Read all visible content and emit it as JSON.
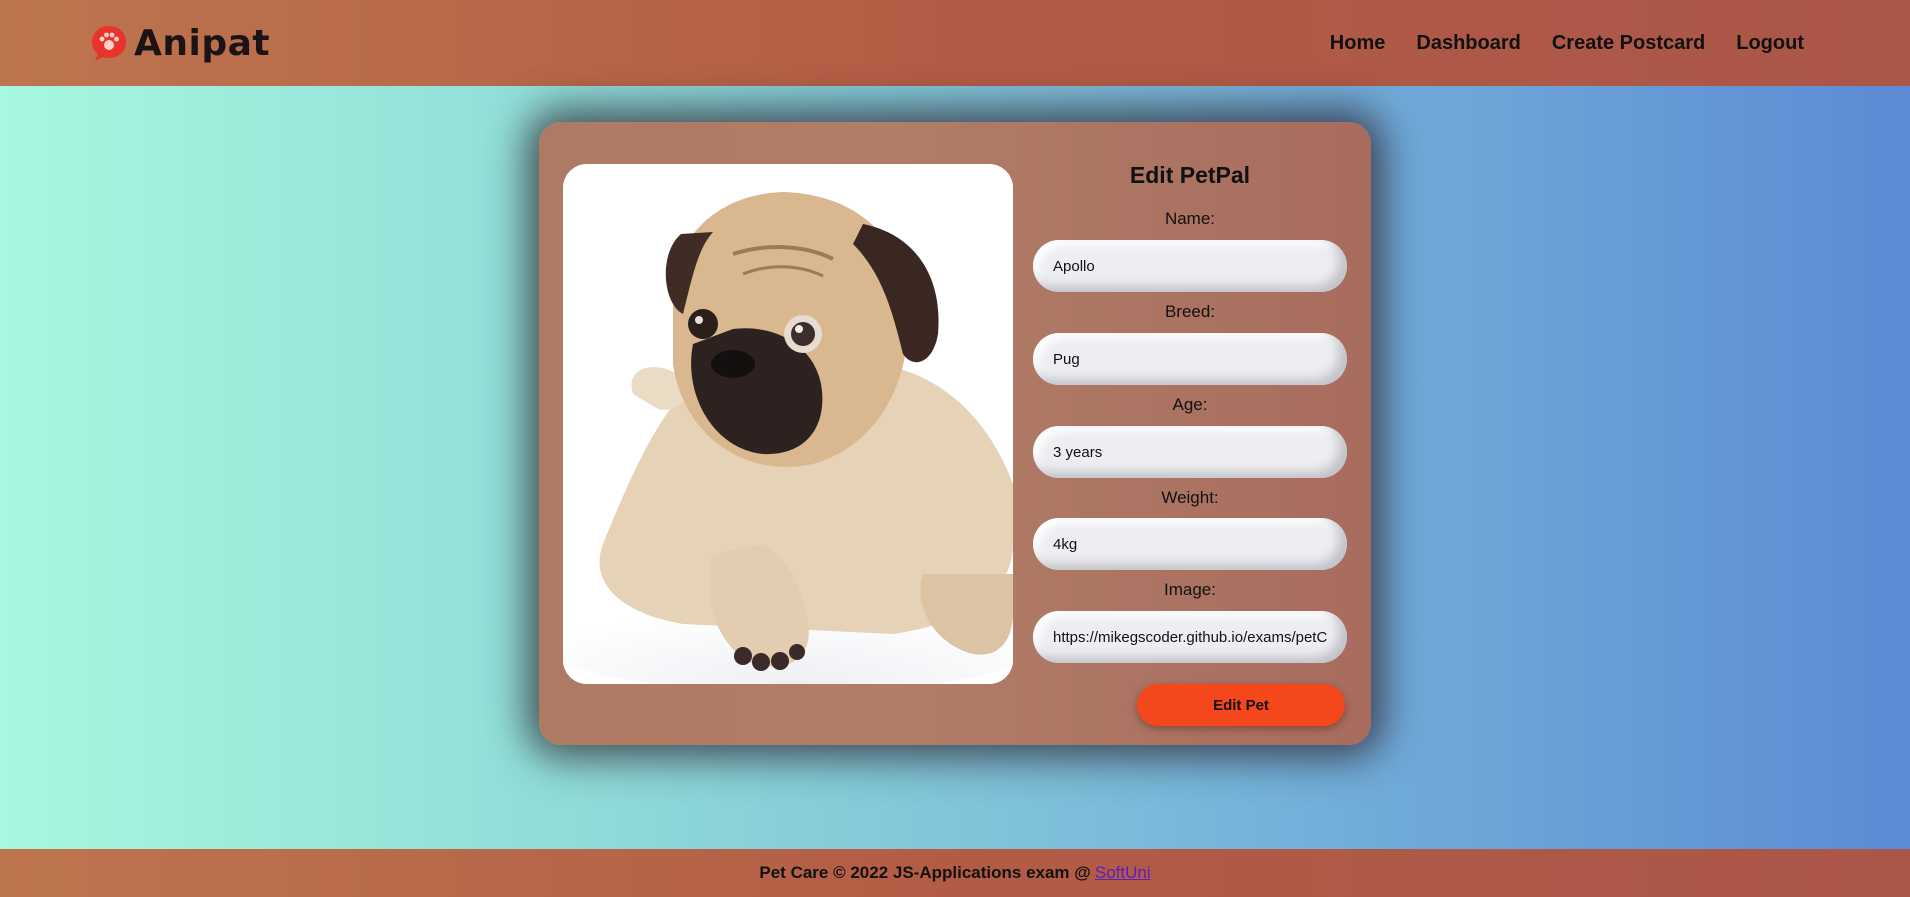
{
  "brand": {
    "name": "Anipat",
    "accent": "#e8342b"
  },
  "nav": {
    "items": [
      {
        "label": "Home"
      },
      {
        "label": "Dashboard"
      },
      {
        "label": "Create Postcard"
      },
      {
        "label": "Logout"
      }
    ]
  },
  "form": {
    "title": "Edit PetPal",
    "fields": [
      {
        "label": "Name:",
        "value": "Apollo"
      },
      {
        "label": "Breed:",
        "value": "Pug"
      },
      {
        "label": "Age:",
        "value": "3 years"
      },
      {
        "label": "Weight:",
        "value": "4kg"
      },
      {
        "label": "Image:",
        "value": "https://mikegscoder.github.io/exams/petCare/images/pug.jpg"
      }
    ],
    "submit_label": "Edit Pet",
    "submit_color": "#f4471c"
  },
  "footer": {
    "text": "Pet Care © 2022 JS-Applications exam @",
    "link_label": "SoftUni"
  }
}
